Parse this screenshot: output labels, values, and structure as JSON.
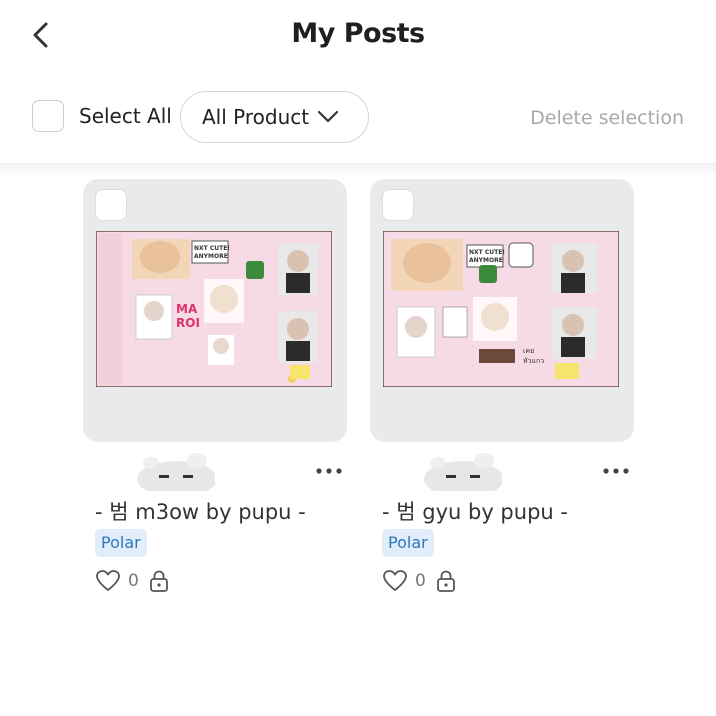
{
  "header": {
    "title": "My Posts",
    "back_icon": "chevron-left-icon"
  },
  "toolbar": {
    "select_all_label": "Select All",
    "product_filter_value": "All Product",
    "delete_selection_label": "Delete selection"
  },
  "posts": [
    {
      "title": "- 범 m3ow by pupu -",
      "tag": "Polar",
      "like_count": "0",
      "collage_text": [
        "NXT CUTE!",
        "ANYMORE",
        "MA",
        "ROI"
      ]
    },
    {
      "title": "- 범 gyu by pupu -",
      "tag": "Polar",
      "like_count": "0",
      "collage_text": [
        "NXT CUTE!",
        "ANYMORE",
        "เคย",
        "หัวแกว"
      ]
    }
  ],
  "colors": {
    "tag_bg": "#e1edf9",
    "tag_text": "#2c79bf",
    "muted_text": "#a8a8a8",
    "card_bg": "#e9eaec",
    "collage_pink": "#f6dbe6"
  }
}
